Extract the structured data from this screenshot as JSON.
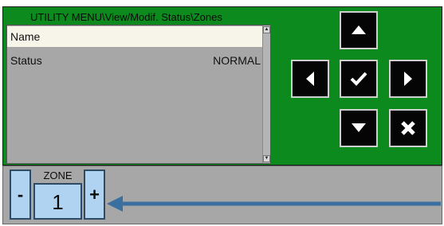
{
  "menu": {
    "title": "UTILITY MENU\\View/Modif. Status\\Zones"
  },
  "list": {
    "rows": [
      {
        "label": "Name",
        "value": ""
      },
      {
        "label": "Status",
        "value": "NORMAL"
      }
    ]
  },
  "nav": {
    "up": "arrow-up-icon",
    "left": "arrow-left-icon",
    "ok": "checkmark-icon",
    "right": "arrow-right-icon",
    "down": "arrow-down-icon",
    "cancel": "cross-icon"
  },
  "zone": {
    "label": "ZONE",
    "value": "1",
    "minus_label": "-",
    "plus_label": "+"
  },
  "colors": {
    "panel_green": "#0d8a1e",
    "list_grey": "#a7a7a7",
    "selected_row": "#f7f4e9",
    "button_black": "#050505",
    "zone_blue": "#b0d3f2",
    "arrow_blue": "#3b6fa0"
  }
}
